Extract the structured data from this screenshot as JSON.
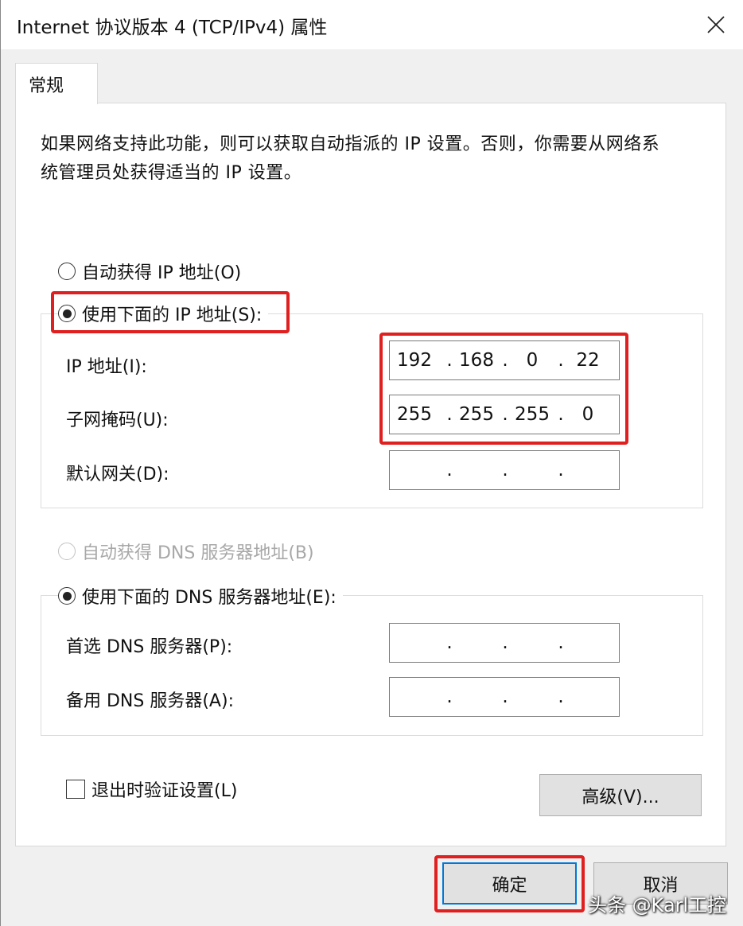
{
  "window": {
    "title": "Internet 协议版本 4 (TCP/IPv4) 属性"
  },
  "tabs": [
    {
      "label": "常规"
    }
  ],
  "description": "如果网络支持此功能，则可以获取自动指派的 IP 设置。否则，你需要从网络系统管理员处获得适当的 IP 设置。",
  "ip_section": {
    "auto_label": "自动获得 IP 地址(O)",
    "manual_label": "使用下面的 IP 地址(S):",
    "selected": "manual",
    "fields": [
      {
        "label": "IP 地址(I):",
        "octets": [
          "192",
          "168",
          "0",
          "22"
        ]
      },
      {
        "label": "子网掩码(U):",
        "octets": [
          "255",
          "255",
          "255",
          "0"
        ]
      },
      {
        "label": "默认网关(D):",
        "octets": [
          "",
          "",
          "",
          ""
        ]
      }
    ]
  },
  "dns_section": {
    "auto_label": "自动获得 DNS 服务器地址(B)",
    "manual_label": "使用下面的 DNS 服务器地址(E):",
    "selected": "manual",
    "auto_disabled": true,
    "fields": [
      {
        "label": "首选 DNS 服务器(P):",
        "octets": [
          "",
          "",
          "",
          ""
        ]
      },
      {
        "label": "备用 DNS 服务器(A):",
        "octets": [
          "",
          "",
          "",
          ""
        ]
      }
    ]
  },
  "validate_on_exit": {
    "label": "退出时验证设置(L)",
    "checked": false
  },
  "buttons": {
    "advanced": "高级(V)...",
    "ok": "确定",
    "cancel": "取消"
  },
  "watermark": "头条 @Karl工控",
  "colors": {
    "highlight": "#e02020",
    "focus": "#0078d7"
  }
}
